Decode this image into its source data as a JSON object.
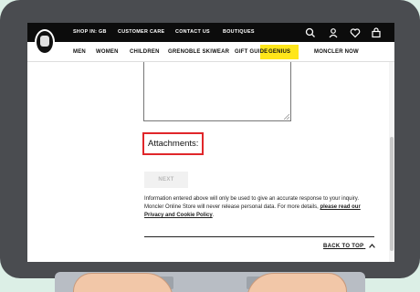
{
  "topbar": {
    "links": [
      "SHOP IN: GB",
      "CUSTOMER CARE",
      "CONTACT US",
      "BOUTIQUES"
    ],
    "icons": [
      "search-icon",
      "account-icon",
      "wishlist-icon",
      "bag-icon"
    ]
  },
  "nav": {
    "items": [
      "MEN",
      "WOMEN",
      "CHILDREN",
      "GRENOBLE SKIWEAR",
      "GIFT GUIDE",
      "GENIUS",
      "MONCLER NOW"
    ],
    "highlight_color": "#ffe61a"
  },
  "form": {
    "attachments_label": "Attachments:",
    "next_label": "NEXT",
    "info_text": "Information entered above will only be used to give an accurate response to your inquiry. Moncler Online Store will never release personal data. For more details,",
    "policy_link": "please read our Privacy and Cookie Policy",
    "policy_suffix": ".",
    "highlight_color": "#e0262a"
  },
  "footer": {
    "back_to_top": "BACK TO TOP"
  }
}
